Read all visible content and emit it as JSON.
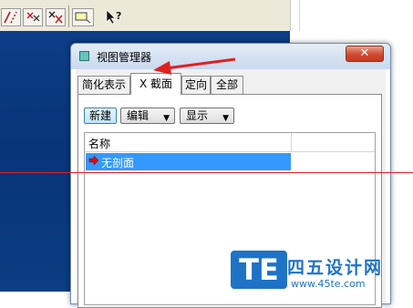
{
  "dialog": {
    "title": "视图管理器",
    "close_label": "✕",
    "tabs": [
      {
        "label": "简化表示",
        "active": false
      },
      {
        "label": "X 截面",
        "active": true
      },
      {
        "label": "定向",
        "active": false
      },
      {
        "label": "全部",
        "active": false
      }
    ],
    "buttons": {
      "new_label": "新建",
      "edit_label": "编辑",
      "display_label": "显示"
    },
    "list": {
      "column_header": "名称",
      "rows": [
        {
          "name": "无剖面",
          "selected": true
        }
      ]
    }
  },
  "toolbar": {
    "icons": [
      "pattern-slash-icon",
      "pattern-x-icon",
      "pattern-xx-icon",
      "note-icon",
      "help-cursor-icon"
    ]
  },
  "colors": {
    "graphics_bg": "#0b3d84",
    "selection": "#3399ff",
    "close_button": "#c73a20",
    "annotation": "#e02020"
  },
  "watermark": {
    "logo": "TE",
    "title": "四五设计网",
    "url": "www.45te.com"
  }
}
